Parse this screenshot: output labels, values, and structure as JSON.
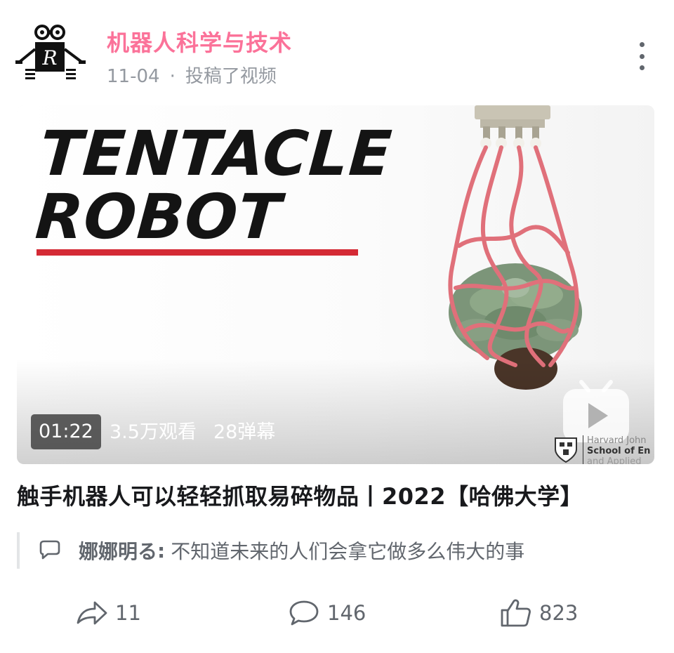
{
  "post": {
    "author": "机器人科学与技术",
    "date": "11-04",
    "separator": "·",
    "action": "投稿了视频",
    "avatar_icon": "robot-logo-icon",
    "more_icon": "more-vertical-icon"
  },
  "video": {
    "thumbnail_text_line1": "TENTACLE",
    "thumbnail_text_line2": "ROBOT",
    "duration": "01:22",
    "views": "3.5万观看",
    "danmaku": "28弹幕",
    "watermark_line1": "Harvard John",
    "watermark_line2": "School of En",
    "watermark_line3": "and Applied",
    "accent_color": "#d42a35",
    "play_icon": "bilibili-play-icon"
  },
  "title": "触手机器人可以轻轻抓取易碎物品丨2022【哈佛大学】",
  "top_comment": {
    "user": "娜娜明る",
    "colon": ":",
    "text": "不知道未来的人们会拿它做多么伟大的事",
    "icon": "comment-bubble-icon"
  },
  "actions": {
    "share_count": "11",
    "comment_count": "146",
    "like_count": "823"
  },
  "colors": {
    "brand_pink": "#fb7299",
    "secondary_text": "#9499a0",
    "icon_gray": "#61666d"
  }
}
